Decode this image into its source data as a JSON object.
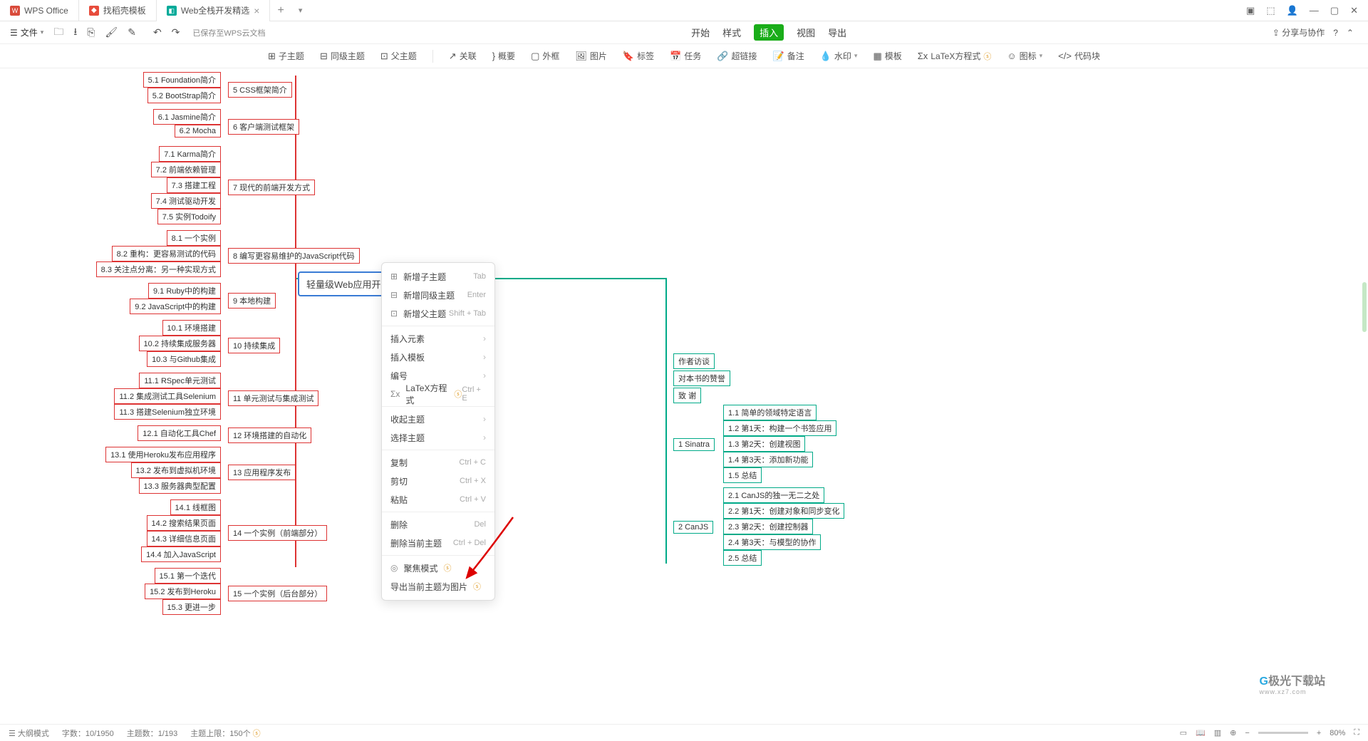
{
  "tabs": [
    {
      "icon": "W",
      "iconColor": "#d94b3b",
      "label": "WPS Office"
    },
    {
      "icon": "♦",
      "iconColor": "#e74c3c",
      "label": "找稻壳模板"
    },
    {
      "icon": "◧",
      "iconColor": "#0a9",
      "label": "Web全栈开发精选"
    }
  ],
  "filebar": {
    "menu": "文件",
    "save_status": "已保存至WPS云文档"
  },
  "menus": {
    "start": "开始",
    "style": "样式",
    "insert": "插入",
    "view": "视图",
    "export": "导出"
  },
  "share_label": "分享与协作",
  "toolbar": {
    "sub": "子主题",
    "same": "同级主题",
    "parent": "父主题",
    "relation": "关联",
    "summary": "概要",
    "border": "外框",
    "image": "图片",
    "label": "标签",
    "task": "任务",
    "hyperlink": "超链接",
    "note": "备注",
    "watermark": "水印",
    "template": "模板",
    "latex": "LaTeX方程式",
    "icon": "图标",
    "code": "代码块"
  },
  "head_node": "轻量级Web应用开发",
  "groups_left": [
    {
      "summary": "5 CSS框架简介",
      "items": [
        "5.1 Foundation简介",
        "5.2 BootStrap简介"
      ]
    },
    {
      "summary": "6 客户端测试框架",
      "items": [
        "6.1 Jasmine简介",
        "6.2 Mocha"
      ]
    },
    {
      "summary": "7 现代的前端开发方式",
      "items": [
        "7.1 Karma简介",
        "7.2 前端依赖管理",
        "7.3 搭建工程",
        "7.4 测试驱动开发",
        "7.5 实例Todoify"
      ]
    },
    {
      "summary": "8 编写更容易维护的JavaScript代码",
      "items": [
        "8.1 一个实例",
        "8.2 重构：更容易测试的代码",
        "8.3 关注点分离：另一种实现方式"
      ]
    },
    {
      "summary": "9 本地构建",
      "items": [
        "9.1 Ruby中的构建",
        "9.2 JavaScript中的构建"
      ]
    },
    {
      "summary": "10 持续集成",
      "items": [
        "10.1 环境搭建",
        "10.2 持续集成服务器",
        "10.3 与Github集成"
      ]
    },
    {
      "summary": "11 单元测试与集成测试",
      "items": [
        "11.1 RSpec单元测试",
        "11.2 集成测试工具Selenium",
        "11.3 搭建Selenium独立环境"
      ]
    },
    {
      "summary": "12 环境搭建的自动化",
      "items": [
        "12.1 自动化工具Chef"
      ]
    },
    {
      "summary": "13 应用程序发布",
      "items": [
        "13.1 使用Heroku发布应用程序",
        "13.2 发布到虚拟机环境",
        "13.3 服务器典型配置"
      ]
    },
    {
      "summary": "14 一个实例（前端部分）",
      "items": [
        "14.1 线框图",
        "14.2 搜索结果页面",
        "14.3 详细信息页面",
        "14.4 加入JavaScript"
      ]
    },
    {
      "summary": "15 一个实例（后台部分）",
      "items": [
        "15.1 第一个迭代",
        "15.2 发布到Heroku",
        "15.3 更进一步"
      ]
    }
  ],
  "groups_right": [
    {
      "label": "作者访谈"
    },
    {
      "label": "对本书的赞誉"
    },
    {
      "label": "致 谢"
    },
    {
      "summary": "1 Sinatra",
      "items": [
        "1.1 简单的领域特定语言",
        "1.2 第1天：构建一个书签应用",
        "1.3 第2天：创建视图",
        "1.4 第3天：添加新功能",
        "1.5 总结"
      ]
    },
    {
      "summary": "2 CanJS",
      "items": [
        "2.1 CanJS的独一无二之处",
        "2.2 第1天：创建对象和同步变化",
        "2.3 第2天：创建控制器",
        "2.4 第3天：与模型的协作",
        "2.5 总结"
      ]
    }
  ],
  "context_menu": {
    "items": [
      {
        "icon": "⊞",
        "label": "新增子主题",
        "shortcut": "Tab"
      },
      {
        "icon": "⊟",
        "label": "新增同级主题",
        "shortcut": "Enter"
      },
      {
        "icon": "⊡",
        "label": "新增父主题",
        "shortcut": "Shift + Tab"
      },
      {
        "divider": true
      },
      {
        "label": "插入元素",
        "arrow": true
      },
      {
        "label": "插入模板",
        "arrow": true
      },
      {
        "label": "编号",
        "arrow": true
      },
      {
        "icon": "Σx",
        "label": "LaTeX方程式",
        "vip": true,
        "shortcut": "Ctrl + E"
      },
      {
        "divider": true
      },
      {
        "label": "收起主题",
        "arrow": true
      },
      {
        "label": "选择主题",
        "arrow": true
      },
      {
        "divider": true
      },
      {
        "label": "复制",
        "shortcut": "Ctrl + C"
      },
      {
        "label": "剪切",
        "shortcut": "Ctrl + X"
      },
      {
        "label": "粘贴",
        "shortcut": "Ctrl + V"
      },
      {
        "divider": true
      },
      {
        "label": "删除",
        "shortcut": "Del"
      },
      {
        "label": "删除当前主题",
        "shortcut": "Ctrl + Del"
      },
      {
        "divider": true
      },
      {
        "icon": "◎",
        "label": "聚焦模式",
        "vip": true
      },
      {
        "label": "导出当前主题为图片",
        "vip": true
      }
    ]
  },
  "statusbar": {
    "outline": "大纲模式",
    "words_lbl": "字数：",
    "words": "10/1950",
    "topics_lbl": "主题数：",
    "topics": "1/193",
    "limit_lbl": "主题上限：",
    "limit": "150个",
    "zoom": "80%"
  },
  "watermark": {
    "brand": "极光下载站",
    "url": "www.xz7.com"
  }
}
